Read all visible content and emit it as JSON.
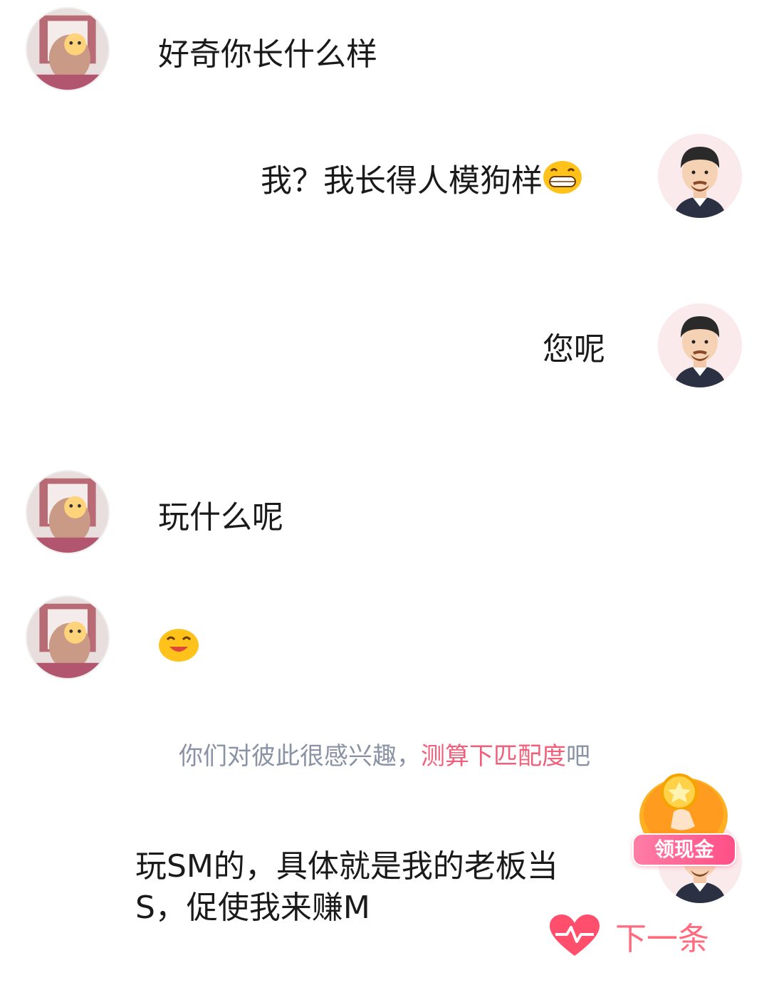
{
  "messages": [
    {
      "sender": "her",
      "text": "好奇你长什么样"
    },
    {
      "sender": "me",
      "text": "我？我长得人模狗样",
      "emoji": "grinning-emoji"
    },
    {
      "sender": "me",
      "text": "您呢"
    },
    {
      "sender": "her",
      "text": "玩什么呢"
    },
    {
      "sender": "her",
      "text": "",
      "emoji": "smiling-emoji"
    },
    {
      "sender": "me",
      "text": "玩SM的，具体就是我的老板当S，促使我来赚M"
    }
  ],
  "hint": {
    "prefix": "你们对彼此很感兴趣，",
    "link": "测算下匹配度",
    "suffix": "吧"
  },
  "cash_button": {
    "label": "领现金"
  },
  "next_button": {
    "label": "下一条",
    "icon": "heartbeat-icon"
  },
  "colors": {
    "accent": "#f0607a",
    "hint": "#8a93a6",
    "next": "#ff6a7e"
  }
}
